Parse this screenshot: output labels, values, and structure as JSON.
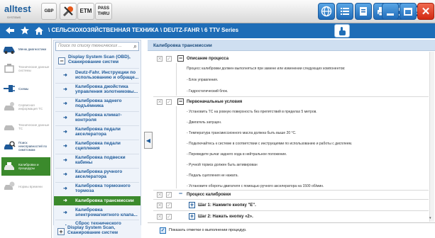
{
  "app": {
    "logo": "alltest",
    "logo_sub": "SYSTEMS",
    "title_badge": "GBP",
    "etm": "ETM",
    "pass_line1": "PASS",
    "pass_line2": "THRU"
  },
  "navbar": {
    "breadcrumb": "\\ СЕЛЬСКОХОЗЯЙСТВЕННАЯ ТЕХНИКА \\ DEUTZ-FAHR \\ 6 TTV Series"
  },
  "leftnav": {
    "items": [
      {
        "label": "Меню диагностики",
        "icon": "car-icon",
        "state": "on"
      },
      {
        "label": "Технические данные системы",
        "icon": "engine-icon",
        "state": "off"
      },
      {
        "label": "Схемы",
        "icon": "wiring-icon",
        "state": "on"
      },
      {
        "label": "Сервисная информация ТС",
        "icon": "service-icon",
        "state": "off"
      },
      {
        "label": "Технические данные ТС",
        "icon": "car-data-icon",
        "state": "off"
      },
      {
        "label": "Поиск неисправностей по симптомам",
        "icon": "search-car-icon",
        "state": "on"
      },
      {
        "label": "Калибровки и процедуры",
        "icon": "calibration-icon",
        "state": "selected"
      },
      {
        "label": "Нормы времени",
        "icon": "clock-icon",
        "state": "off"
      }
    ]
  },
  "listpanel": {
    "search_placeholder": "Поиск по списку технических ...",
    "items": [
      {
        "label": "Display System Scan (OBD), Сканирование систем",
        "kind": "group",
        "marker": "−"
      },
      {
        "label": "Deutz-Fahr. Инструкции по использованию и обраще...",
        "kind": "item"
      },
      {
        "label": "Калибровка джойстика управления золотниковы...",
        "kind": "item"
      },
      {
        "label": "Калибровка заднего подъёмника",
        "kind": "item"
      },
      {
        "label": "Калибровка климат-контроля",
        "kind": "item"
      },
      {
        "label": "Калибровка педали акселератора",
        "kind": "item"
      },
      {
        "label": "Калибровка педали сцепления",
        "kind": "item"
      },
      {
        "label": "Калибровка подвески кабины",
        "kind": "item"
      },
      {
        "label": "Калибровка ручного акселератора",
        "kind": "item"
      },
      {
        "label": "Калибровка тормозного тормоза",
        "kind": "item"
      },
      {
        "label": "Калибровка трансмиссии",
        "kind": "selected"
      },
      {
        "label": "Калибровка электромагнитного клапа...",
        "kind": "item"
      },
      {
        "label": "Сброс технического обслуживания",
        "kind": "item"
      },
      {
        "label": "Display System Scan, Сканирование систем",
        "kind": "group",
        "marker": "+"
      }
    ]
  },
  "content": {
    "header": "Калибровка трансмиссии",
    "sections": [
      {
        "title": "Описание процесса",
        "marker": "−",
        "paragraphs": [
          "Процесс калибровки должен выполняться при замене или изменении следующих компонентов:",
          "- Блок управления.",
          "- Гидростатический блок."
        ]
      },
      {
        "title": "Первоначальные условия",
        "marker": "−",
        "paragraphs": [
          "- Установить ТС на ровную поверхность без препятствий в пределах 5 метров.",
          "- Двигатель запущен.",
          "- Температура трансмиссионного масла должна быть выше 20 °C.",
          "- Подключайтесь к системе в соответствии с инструкциями по использованию и работы с дисплеем.",
          "- Переведите рычаг заднего хода в нейтральное положение.",
          "- Ручной тормоз должен быть активирован",
          "- Педаль сцепления не нажата.",
          "- Установите обороты двигателя с помощью ручного акселератора на 1500 об/мин."
        ]
      },
      {
        "title": "Процесс калибровки",
        "marker": "−",
        "steps": [
          {
            "label": "Шаг 1: Нажмите кнопку \"E\".",
            "marker": "+"
          },
          {
            "label": "Шаг 2: Нажать кнопку «2».",
            "marker": "+"
          }
        ]
      }
    ],
    "footer_checkbox": "Показать отметки о выполнении процедур."
  },
  "colors": {
    "accent_blue": "#1e6db7",
    "selected_green": "#3b8a2c",
    "close_red": "#e1351f"
  }
}
